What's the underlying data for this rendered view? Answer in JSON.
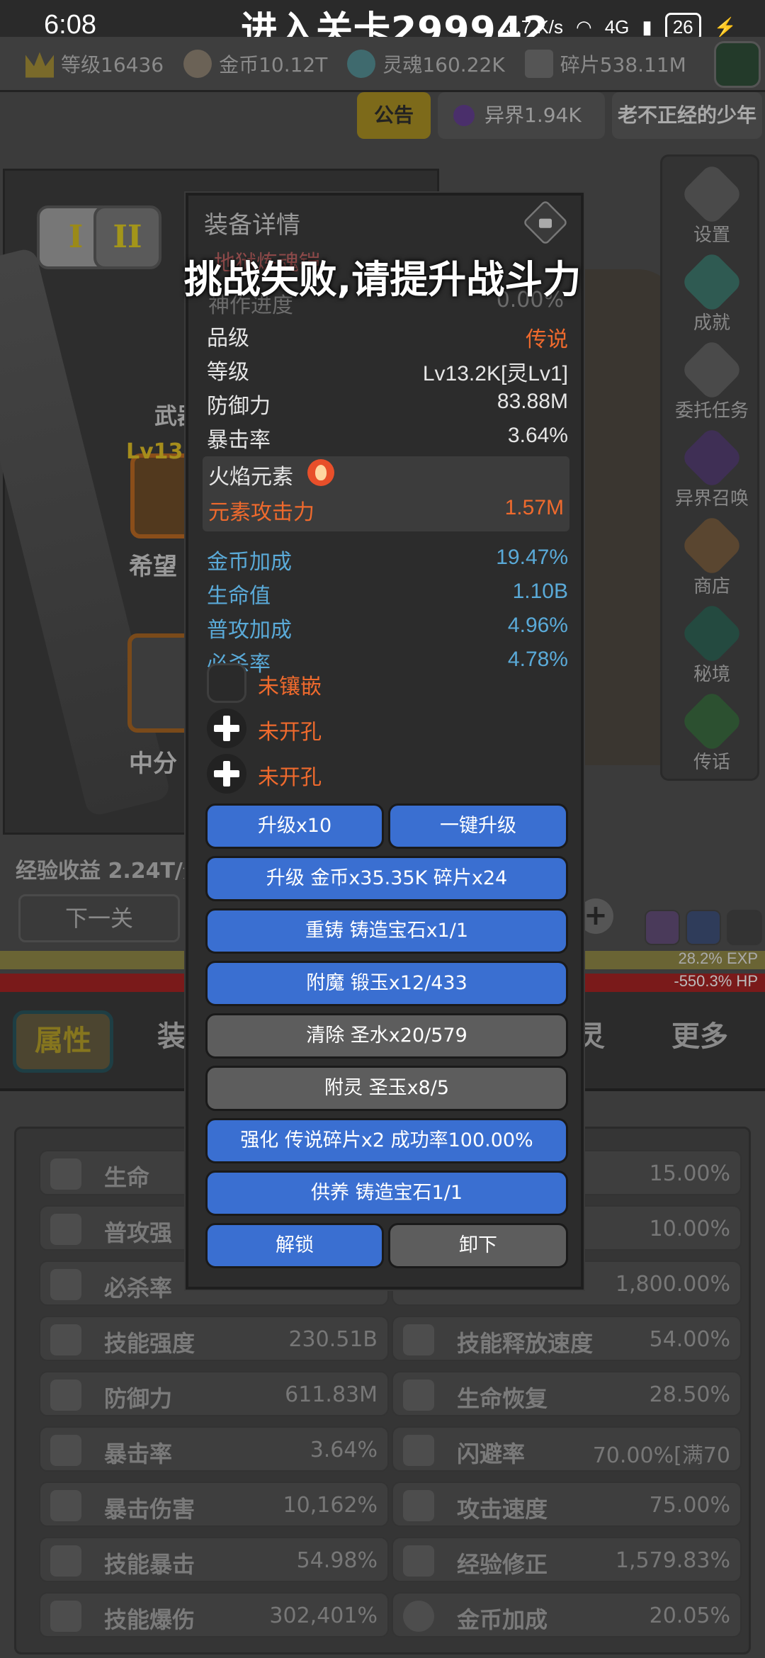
{
  "status": {
    "time": "6:08",
    "net_speed": "3.7 K/s",
    "network": "4G",
    "battery": "26"
  },
  "stage_title": "进入关卡299942",
  "resources": [
    {
      "icon": "level-crown-icon",
      "label": "等级16436"
    },
    {
      "icon": "gold-coin-icon",
      "label": "金币10.12T"
    },
    {
      "icon": "soul-icon",
      "label": "灵魂160.22K"
    },
    {
      "icon": "fragment-icon",
      "label": "碎片538.11M"
    }
  ],
  "top_bar": {
    "notice": "公告",
    "otherworld": "异界1.94K",
    "player_name": "老不正经的少年"
  },
  "hero": {
    "tier_buttons": [
      "I",
      "II"
    ],
    "weapon_label": "武器",
    "weapon_level": "Lv13",
    "weapon_name": "希望",
    "armor_name": "中分",
    "exp_income": "经验收益 2.24T/分",
    "next_stage": "下一关"
  },
  "side_menu": [
    {
      "icon": "settings-icon",
      "label": "设置"
    },
    {
      "icon": "achievement-icon",
      "label": "成就"
    },
    {
      "icon": "quest-icon",
      "label": "委托任务"
    },
    {
      "icon": "summon-icon",
      "label": "异界召唤"
    },
    {
      "icon": "shop-icon",
      "label": "商店"
    },
    {
      "icon": "secret-realm-icon",
      "label": "秘境"
    },
    {
      "icon": "legend-icon",
      "label": "传话"
    }
  ],
  "bars": {
    "exp_text": "28.2% EXP",
    "hp_text": "-550.3% HP"
  },
  "tabs": [
    "属性",
    "装",
    "灵",
    "更多"
  ],
  "stats_left": [
    {
      "name": "生命",
      "value": ""
    },
    {
      "name": "普攻强",
      "value": ""
    },
    {
      "name": "必杀率",
      "value": ""
    },
    {
      "name": "技能强度",
      "value": "230.51B"
    },
    {
      "name": "防御力",
      "value": "611.83M"
    },
    {
      "name": "暴击率",
      "value": "3.64%"
    },
    {
      "name": "暴击伤害",
      "value": "10,162%"
    },
    {
      "name": "技能暴击",
      "value": "54.98%"
    },
    {
      "name": "技能爆伤",
      "value": "302,401%"
    }
  ],
  "stats_right": [
    {
      "name": "",
      "value": "15.00%"
    },
    {
      "name": "",
      "value": "10.00%"
    },
    {
      "name": "",
      "value": "1,800.00%"
    },
    {
      "name": "技能释放速度",
      "value": "54.00%"
    },
    {
      "name": "生命恢复",
      "value": "28.50%"
    },
    {
      "name": "闪避率",
      "value": "70.00%[满70"
    },
    {
      "name": "攻击速度",
      "value": "75.00%"
    },
    {
      "name": "经验修正",
      "value": "1,579.83%"
    },
    {
      "name": "金币加成",
      "value": "20.05%"
    }
  ],
  "modal": {
    "title": "装备详情",
    "hidden_name": "地狱炼魂铠",
    "hidden_progress_label": "神作进度",
    "hidden_progress_value": "0.00%",
    "rows": [
      {
        "label": "品级",
        "value": "传说"
      },
      {
        "label": "等级",
        "value": "Lv13.2K[灵Lv1]"
      },
      {
        "label": "防御力",
        "value": "83.88M"
      },
      {
        "label": "暴击率",
        "value": "3.64%"
      }
    ],
    "element": {
      "name": "火焰元素",
      "attack_label": "元素攻击力",
      "attack_value": "1.57M"
    },
    "bonuses": [
      {
        "label": "金币加成",
        "value": "19.47%"
      },
      {
        "label": "生命值",
        "value": "1.10B"
      },
      {
        "label": "普攻加成",
        "value": "4.96%"
      },
      {
        "label": "必杀率",
        "value": "4.78%"
      }
    ],
    "slots": [
      "未镶嵌",
      "未开孔",
      "未开孔"
    ],
    "buttons": {
      "upgrade_x10": "升级x10",
      "one_click_upgrade": "一键升级",
      "upgrade_cost": "升级 金币x35.35K 碎片x24",
      "reforge": "重铸 铸造宝石x1/1",
      "enchant": "附魔 锻玉x12/433",
      "clear": "清除 圣水x20/579",
      "spirit": "附灵 圣玉x8/5",
      "strengthen": "强化 传说碎片x2 成功率100.00%",
      "nurture": "供养 铸造宝石1/1",
      "unlock": "解锁",
      "unequip": "卸下"
    }
  },
  "toast": "挑战失败,请提升战斗力"
}
